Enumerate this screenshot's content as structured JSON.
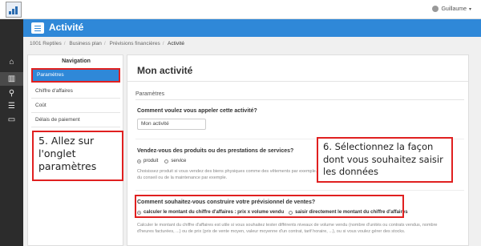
{
  "topbar": {
    "user_name": "Guillaume",
    "caret": "▾"
  },
  "sidebar": {
    "icons": [
      "home-icon",
      "chart-icon",
      "search-icon",
      "list-icon",
      "folder-open-icon"
    ],
    "glyphs": [
      "⌂",
      "▥",
      "⚲",
      "☰",
      "▭"
    ]
  },
  "header": {
    "title": "Activité"
  },
  "breadcrumb": {
    "items": [
      "1001 Reptiles",
      "Business plan",
      "Prévisions financières",
      "Activité"
    ]
  },
  "nav": {
    "title": "Navigation",
    "items": [
      {
        "label": "Paramètres"
      },
      {
        "label": "Chiffre d'affaires"
      },
      {
        "label": "Coût"
      },
      {
        "label": "Délais de paiement"
      }
    ]
  },
  "main": {
    "title": "Mon activité",
    "section": "Paramètres",
    "q1": {
      "label": "Comment voulez vous appeler cette activité?",
      "value": "Mon activité"
    },
    "q2": {
      "label": "Vendez-vous des produits ou des prestations de services?",
      "options": [
        "produit",
        "service"
      ],
      "selected": "produit",
      "help_line1": "Choisissez produit si vous vendez des biens physiques comme des vêtements par exemple. Choisissez service si vous vendez des",
      "help_line2": "du conseil ou de la maintenance par exemple."
    },
    "q3": {
      "label": "Comment souhaitez-vous construire votre prévisionnel de ventes?",
      "options": [
        "calculer le montant du chiffre d'affaires : prix x volume vendu",
        "saisir directement le montant du chiffre d'affaires"
      ],
      "selected": "calculer le montant du chiffre d'affaires : prix x volume vendu",
      "help_line1": "Calculer le montant du chiffre d'affaires est utile si vous souhaitez tester différents niveaux de volume vendu (nombre d'unités ou contrats vendus, nombre",
      "help_line2": "d'heures facturées, ...) ou de prix (prix de vente moyen, valeur moyenne d'un contrat, tarif horaire, ...), ou si vous voulez gérer des stocks."
    }
  },
  "annotations": {
    "step5": [
      "5. Allez sur",
      "l'onglet",
      "paramètres"
    ],
    "step6": [
      "6. Sélectionnez  la façon",
      "dont vous souhaitez saisir",
      "les données"
    ]
  },
  "colors": {
    "accent": "#2f88d8",
    "sidebar": "#2c2c2c",
    "annotation_border": "#e02020"
  }
}
